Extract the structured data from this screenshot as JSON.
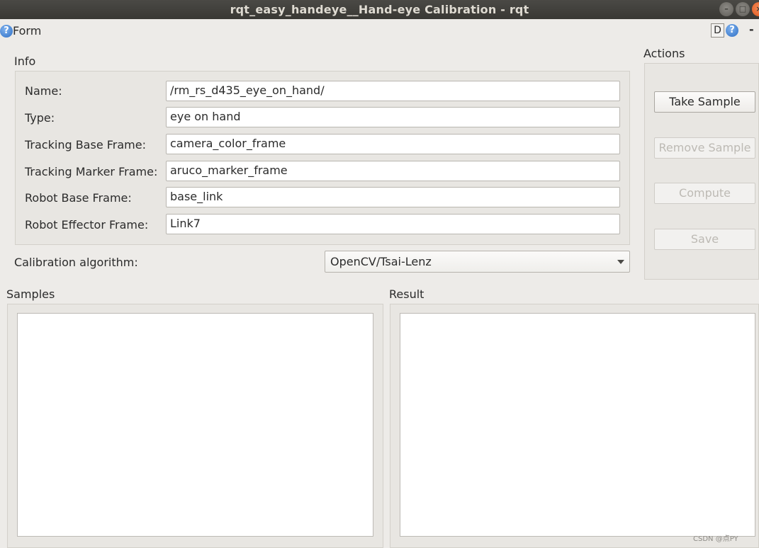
{
  "window": {
    "title": "rqt_easy_handeye__Hand-eye Calibration - rqt"
  },
  "plugin": {
    "form_label": "Form",
    "d_label": "D",
    "dash_label": "-",
    "help_glyph": "?"
  },
  "info": {
    "title": "Info",
    "rows": [
      {
        "label": "Name:",
        "value": "/rm_rs_d435_eye_on_hand/"
      },
      {
        "label": "Type:",
        "value": "eye on hand"
      },
      {
        "label": "Tracking Base Frame:",
        "value": "camera_color_frame"
      },
      {
        "label": "Tracking Marker Frame:",
        "value": "aruco_marker_frame"
      },
      {
        "label": "Robot Base Frame:",
        "value": "base_link"
      },
      {
        "label": "Robot Effector Frame:",
        "value": "Link7"
      }
    ]
  },
  "calibration": {
    "label": "Calibration algorithm:",
    "selected": "OpenCV/Tsai-Lenz"
  },
  "actions": {
    "title": "Actions",
    "take_sample": "Take Sample",
    "remove_sample": "Remove Sample",
    "compute": "Compute",
    "save": "Save"
  },
  "samples": {
    "title": "Samples"
  },
  "result": {
    "title": "Result"
  },
  "watermark": "CSDN @点PY",
  "colors": {
    "titlebar": "#3c3b37",
    "background": "#edebe8",
    "close_button": "#e9622a",
    "help_icon": "#2f6fc4"
  }
}
